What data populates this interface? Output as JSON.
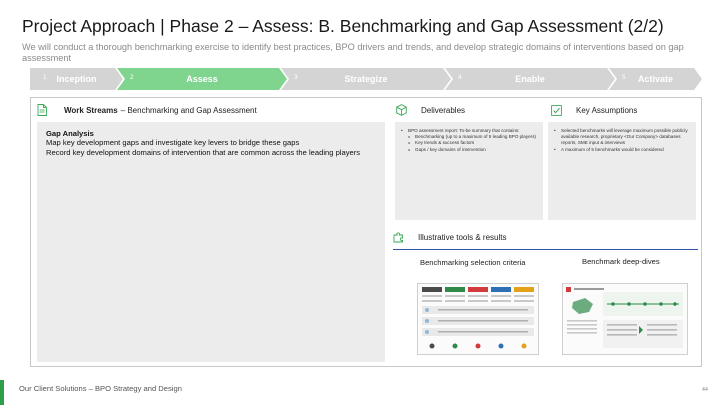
{
  "title": "Project Approach | Phase 2 – Assess: B. Benchmarking and Gap Assessment (2/2)",
  "subtitle": "We will conduct a thorough benchmarking exercise to identify best practices, BPO drivers and trends, and develop strategic domains of interventions based on gap assessment",
  "phases": [
    {
      "num": "1",
      "label": "Inception",
      "state": "inactive"
    },
    {
      "num": "2",
      "label": "Assess",
      "state": "active"
    },
    {
      "num": "3",
      "label": "Strategize",
      "state": "inactive"
    },
    {
      "num": "4",
      "label": "Enable",
      "state": "inactive"
    },
    {
      "num": "5",
      "label": "Activate",
      "state": "inactive"
    }
  ],
  "work_streams": {
    "heading_bold": "Work Streams",
    "heading_rest": "– Benchmarking and Gap Assessment",
    "section_title": "Gap Analysis",
    "lines": [
      "Map key development gaps and investigate key levers to bridge these gaps",
      "Record key development domains of intervention that are common across the leading players"
    ]
  },
  "deliverables": {
    "heading": "Deliverables",
    "items": [
      {
        "type": "bullet",
        "text": "BPO assessment report: To-be summary that contains:"
      },
      {
        "type": "sub",
        "text": "Benchmarking (up to a maximum of 5 leading BPO players)"
      },
      {
        "type": "sub",
        "text": "Key trends & success factors"
      },
      {
        "type": "sub",
        "text": "Gaps / key domains of intervention"
      }
    ]
  },
  "assumptions": {
    "heading": "Key Assumptions",
    "items": [
      {
        "type": "bullet",
        "text": "Selected benchmarks will leverage maximum possible publicly available research, proprietary <Our Company> databases reports, SME input & interviews"
      },
      {
        "type": "bullet",
        "text": "A maximum of 5 benchmarks would be considered"
      }
    ]
  },
  "tools": {
    "heading": "Illustrative tools & results",
    "caption_1": "Benchmarking selection criteria",
    "caption_2": "Benchmark deep-dives"
  },
  "colors": {
    "accent_green": "#7fd48e",
    "footer_green": "#2e9e4a",
    "rule_blue": "#2f55a5",
    "inactive_gray": "#d4d4d4",
    "panel_gray": "#ececec"
  },
  "footer": {
    "text": "Our Client Solutions – BPO Strategy and Design",
    "page": "44"
  }
}
